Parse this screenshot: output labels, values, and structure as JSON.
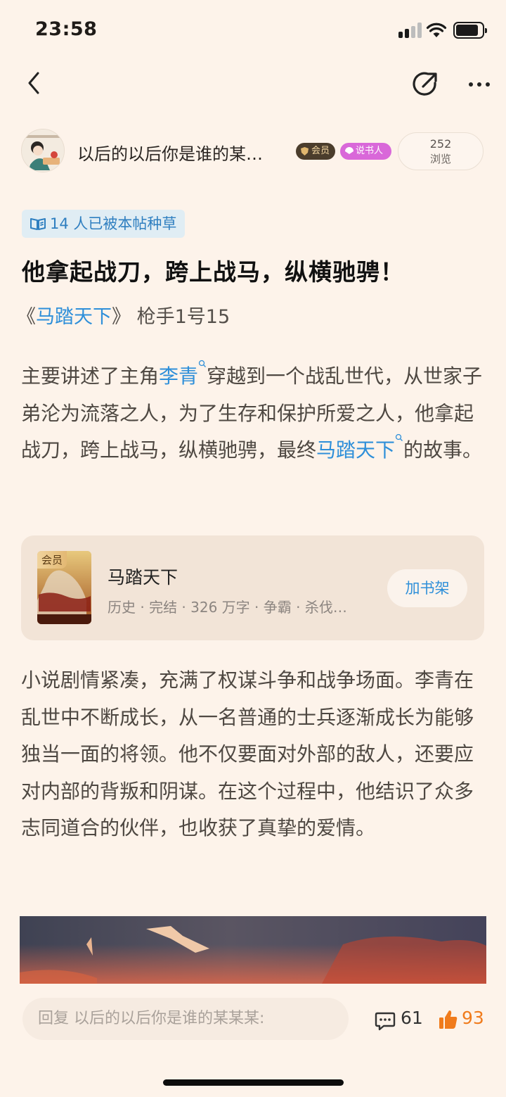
{
  "status": {
    "time": "23:58"
  },
  "author": {
    "name": "以后的以后你是谁的某…",
    "badge_vip": "会员",
    "badge_story": "说书人",
    "views_count": "252",
    "views_label": "浏览"
  },
  "tag": {
    "text": "14 人已被本帖种草"
  },
  "post": {
    "title": "他拿起战刀，跨上战马，纵横驰骋！",
    "ref_open": "《",
    "ref_book": "马踏天下",
    "ref_close": "》",
    "ref_author": "枪手1号15",
    "para1": {
      "a": "主要讲述了主角",
      "link1": "李青",
      "b": "穿越到一个战乱世代，从世家子弟沦为流落之人，为了生存和保护所爱之人，他拿起战刀，跨上战马，纵横驰骋，最终",
      "link2": "马踏天下",
      "c": "的故事。"
    },
    "para2": "小说剧情紧凑，充满了权谋斗争和战争场面。李青在乱世中不断成长，从一名普通的士兵逐渐成长为能够独当一面的将领。他不仅要面对外部的敌人，还要应对内部的背叛和阴谋。在这个过程中，他结识了众多志同道合的伙伴，也收获了真挚的爱情。"
  },
  "book_card": {
    "vip_label": "会员",
    "title": "马踏天下",
    "meta": "历史 · 完结 · 326 万字 · 争霸 · 杀伐…",
    "add_button": "加书架"
  },
  "bottom": {
    "reply_placeholder": "回复 以后的以后你是谁的某某某:",
    "comment_count": "61",
    "like_count": "93"
  },
  "colors": {
    "background": "#fdf3ea",
    "link_blue": "#2e8fd9",
    "like_orange": "#f07b1c"
  }
}
